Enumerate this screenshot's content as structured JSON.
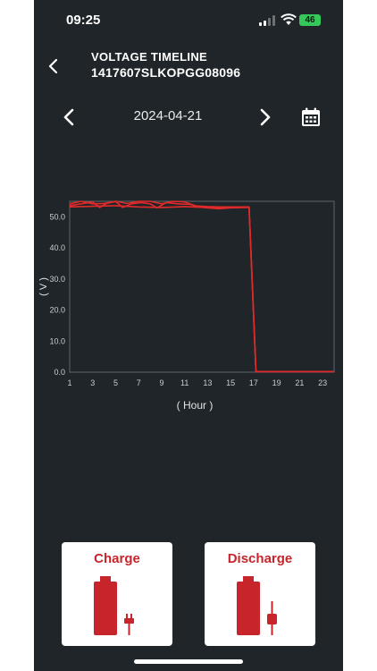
{
  "status_bar": {
    "time": "09:25",
    "battery": "46"
  },
  "header": {
    "title": "VOLTAGE TIMELINE",
    "serial": "1417607SLKOPGG08096"
  },
  "date_nav": {
    "date": "2024-04-21"
  },
  "chart_data": {
    "type": "line",
    "title": "",
    "xlabel": "( Hour )",
    "ylabel": "( V )",
    "xlim": [
      1,
      24
    ],
    "ylim": [
      0,
      55
    ],
    "x_ticks": [
      "1",
      "3",
      "5",
      "7",
      "9",
      "11",
      "13",
      "15",
      "17",
      "19",
      "21",
      "23"
    ],
    "y_ticks": [
      "0.0",
      "10.0",
      "20.0",
      "30.0",
      "40.0",
      "50.0"
    ],
    "grid": false,
    "series": [
      {
        "values": [
          [
            1,
            53.6
          ],
          [
            2,
            54.2
          ],
          [
            3,
            54.8
          ],
          [
            3.6,
            53.0
          ],
          [
            4.2,
            54.3
          ],
          [
            5,
            54.9
          ],
          [
            5.6,
            53.0
          ],
          [
            6.4,
            54.2
          ],
          [
            7.2,
            54.6
          ],
          [
            8,
            54.2
          ],
          [
            8.6,
            52.9
          ],
          [
            9.4,
            54.6
          ],
          [
            10.4,
            54.2
          ],
          [
            11.5,
            54.0
          ],
          [
            12.2,
            53.2
          ],
          [
            13,
            52.9
          ],
          [
            14,
            52.6
          ],
          [
            15,
            52.9
          ],
          [
            16.4,
            53.0
          ],
          [
            16.6,
            53.0
          ],
          [
            17.2,
            0.2
          ],
          [
            24,
            0.2
          ]
        ]
      },
      {
        "values": [
          [
            1,
            54.2
          ],
          [
            2,
            55.0
          ],
          [
            3,
            54.2
          ],
          [
            4,
            54.3
          ],
          [
            5,
            55.0
          ],
          [
            6,
            54.3
          ],
          [
            7,
            55.0
          ],
          [
            8,
            55.0
          ],
          [
            9,
            54.2
          ],
          [
            10,
            55.0
          ],
          [
            11,
            54.8
          ],
          [
            12,
            53.5
          ],
          [
            13,
            53.3
          ],
          [
            14,
            53.2
          ],
          [
            16.4,
            53.2
          ],
          [
            16.6,
            53.2
          ],
          [
            17.2,
            0.2
          ],
          [
            24,
            0.2
          ]
        ]
      },
      {
        "values": [
          [
            1,
            53.2
          ],
          [
            3,
            53.4
          ],
          [
            5,
            53.6
          ],
          [
            7,
            53.2
          ],
          [
            9,
            53.0
          ],
          [
            11,
            53.3
          ],
          [
            13,
            53.0
          ],
          [
            15,
            53.1
          ],
          [
            16.6,
            53.1
          ],
          [
            17.2,
            0.2
          ],
          [
            24,
            0.2
          ]
        ]
      }
    ]
  },
  "actions": {
    "charge_label": "Charge",
    "discharge_label": "Discharge"
  },
  "colors": {
    "background": "#1f2528",
    "accent": "#c8242b",
    "line": "#e02a2a",
    "axis": "#8a9196"
  },
  "icons": {
    "back": "chevron-left-icon",
    "prev": "chevron-left-icon",
    "next": "chevron-right-icon",
    "calendar": "calendar-icon",
    "charge": "battery-plug-icon",
    "discharge": "battery-plug-icon"
  }
}
